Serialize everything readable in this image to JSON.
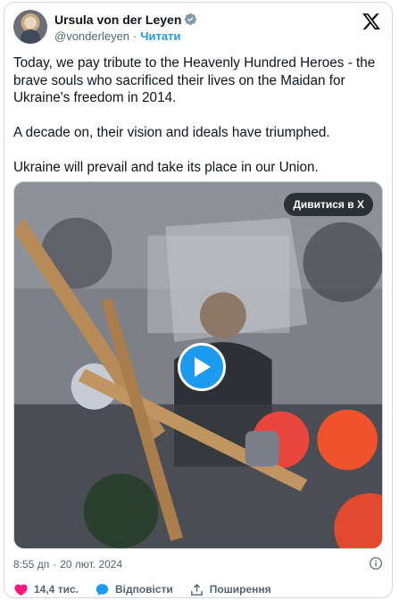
{
  "author": {
    "display_name": "Ursula von der Leyen",
    "handle": "@vonderleyen",
    "separator": "·",
    "follow_label": "Читати"
  },
  "tweet": {
    "text": "Today, we pay tribute to the Heavenly Hundred Heroes - the brave souls who sacrificed their lives on the Maidan for Ukraine's freedom in 2014.\n\nA decade on, their vision and ideals have triumphed.\n\nUkraine will prevail and take its place in our Union."
  },
  "media": {
    "watch_on_x_label": "Дивитися в X",
    "play_icon": "play-icon"
  },
  "meta": {
    "time": "8:55 дп",
    "separator": "·",
    "date": "20 лют. 2024"
  },
  "actions": {
    "like_count": "14,4 тис.",
    "reply_label": "Відповісти",
    "share_label": "Поширення"
  },
  "colors": {
    "accent": "#1d9bf0",
    "like": "#f91880",
    "text": "#0f1419",
    "muted": "#536471"
  }
}
